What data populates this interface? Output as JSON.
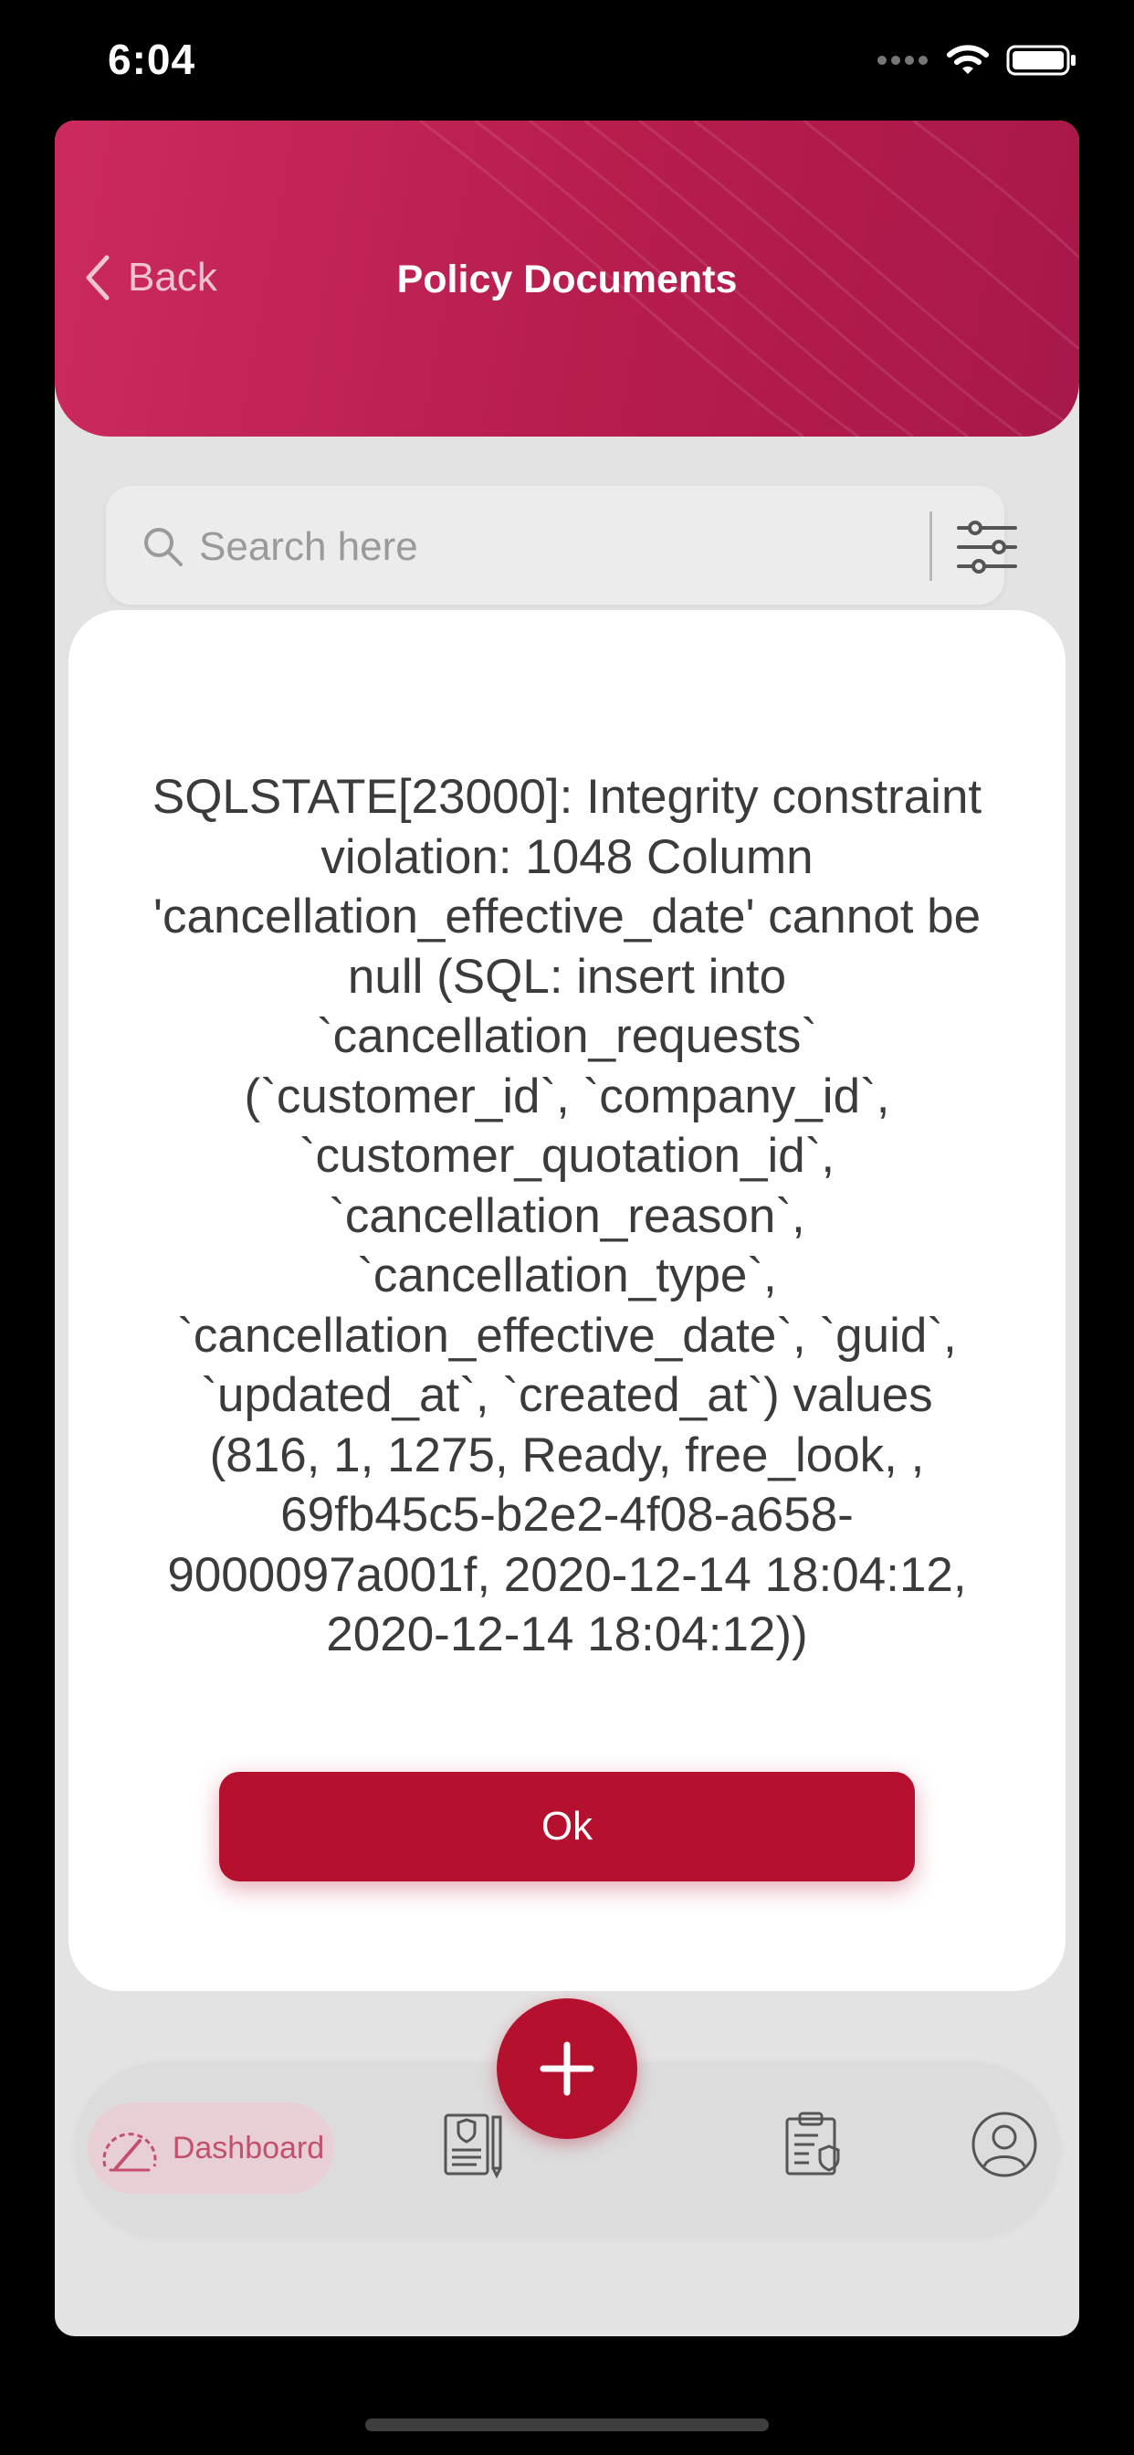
{
  "status_bar": {
    "time": "6:04"
  },
  "header": {
    "back_label": "Back",
    "title": "Policy Documents",
    "gradient_colors": [
      "#cc2a5e",
      "#a8184a"
    ]
  },
  "search": {
    "placeholder": "Search here"
  },
  "dialog": {
    "message": "SQLSTATE[23000]: Integrity constraint violation: 1048 Column 'cancellation_effective_date' cannot be null (SQL: insert into `cancellation_requests` (`customer_id`, `company_id`, `customer_quotation_id`, `cancellation_reason`, `cancellation_type`, `cancellation_effective_date`, `guid`, `updated_at`, `created_at`) values (816, 1, 1275, Ready, free_look, , 69fb45c5-b2e2-4f08-a658-9000097a001f, 2020-12-14 18:04:12, 2020-12-14 18:04:12))",
    "ok_label": "Ok"
  },
  "bottom_nav": {
    "items": [
      {
        "label": "Dashboard",
        "icon": "speedometer-icon",
        "active": true
      },
      {
        "label": "",
        "icon": "policy-document-icon",
        "active": false
      },
      {
        "label": "",
        "icon": "claims-clipboard-icon",
        "active": false
      },
      {
        "label": "",
        "icon": "profile-icon",
        "active": false
      }
    ],
    "fab_icon": "plus-icon"
  },
  "colors": {
    "accent": "#b5112f",
    "background": "#e3e3e3",
    "dashboard_pill": "#e8cfd6"
  }
}
